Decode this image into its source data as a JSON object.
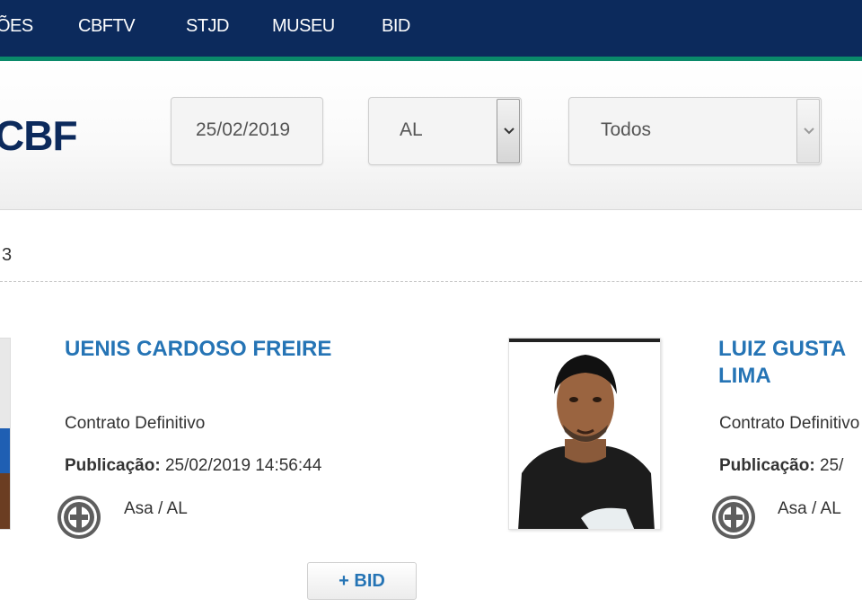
{
  "nav": {
    "items": [
      "ÕES",
      "CBFTV",
      "STJD",
      "MUSEU",
      "BID"
    ]
  },
  "header": {
    "logo_text": "CBF",
    "date_value": "25/02/2019",
    "state_value": "AL",
    "club_value": "Todos"
  },
  "results": {
    "count_text": "3"
  },
  "cards": [
    {
      "name": "UENIS CARDOSO FREIRE",
      "contract": "Contrato Definitivo",
      "publication_label": "Publicação:",
      "publication_value": "25/02/2019 14:56:44",
      "club": "Asa / AL",
      "button_label": "+ BID"
    },
    {
      "name_line1": "LUIZ GUSTA",
      "name_line2": "LIMA",
      "contract": "Contrato Definitivo",
      "publication_label": "Publicação:",
      "publication_value": "25/",
      "club": "Asa / AL"
    }
  ],
  "icons": {
    "dropdown": "chevron-down-icon",
    "club_badge": "club-crest-icon"
  },
  "colors": {
    "nav_bg": "#0c2a5c",
    "nav_stripe": "#0a8a6a",
    "link_blue": "#2574b5"
  }
}
